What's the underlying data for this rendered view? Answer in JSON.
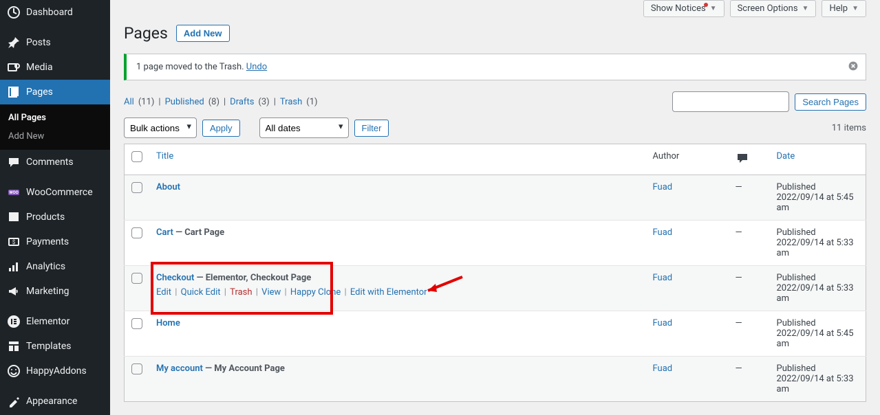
{
  "sidebar": {
    "items": [
      {
        "label": "Dashboard",
        "icon": "dashboard"
      },
      {
        "label": "Posts",
        "icon": "posts"
      },
      {
        "label": "Media",
        "icon": "media"
      },
      {
        "label": "Pages",
        "icon": "pages",
        "active": true
      },
      {
        "label": "Comments",
        "icon": "comments"
      },
      {
        "label": "WooCommerce",
        "icon": "woo"
      },
      {
        "label": "Products",
        "icon": "products"
      },
      {
        "label": "Payments",
        "icon": "payments"
      },
      {
        "label": "Analytics",
        "icon": "analytics"
      },
      {
        "label": "Marketing",
        "icon": "marketing"
      },
      {
        "label": "Elementor",
        "icon": "elementor"
      },
      {
        "label": "Templates",
        "icon": "templates"
      },
      {
        "label": "HappyAddons",
        "icon": "happy"
      },
      {
        "label": "Appearance",
        "icon": "appearance"
      }
    ],
    "sub": [
      {
        "label": "All Pages",
        "current": true
      },
      {
        "label": "Add New"
      }
    ]
  },
  "topbar": {
    "show_notices": "Show Notices",
    "screen_options": "Screen Options",
    "help": "Help"
  },
  "header": {
    "title": "Pages",
    "add_new": "Add New"
  },
  "notice": {
    "text": "1 page moved to the Trash.",
    "undo": "Undo"
  },
  "filters": {
    "all": "All",
    "all_count": "(11)",
    "published": "Published",
    "published_count": "(8)",
    "drafts": "Drafts",
    "drafts_count": "(3)",
    "trash": "Trash",
    "trash_count": "(1)"
  },
  "search_btn": "Search Pages",
  "bulk": {
    "bulk_actions": "Bulk actions",
    "apply": "Apply",
    "all_dates": "All dates",
    "filter": "Filter",
    "items_count": "11 items"
  },
  "columns": {
    "title": "Title",
    "author": "Author",
    "date": "Date"
  },
  "rows": [
    {
      "title": "About",
      "meta": "",
      "author": "Fuad",
      "comments": "—",
      "date_status": "Published",
      "date": "2022/09/14 at 5:45 am"
    },
    {
      "title": "Cart",
      "meta": " — Cart Page",
      "author": "Fuad",
      "comments": "—",
      "date_status": "Published",
      "date": "2022/09/14 at 5:33 am"
    },
    {
      "title": "Checkout",
      "meta": " — Elementor, Checkout Page",
      "author": "Fuad",
      "comments": "—",
      "date_status": "Published",
      "date": "2022/09/14 at 5:33 am",
      "show_actions": true,
      "highlight": true,
      "actions": {
        "edit": "Edit",
        "quick_edit": "Quick Edit",
        "trash": "Trash",
        "view": "View",
        "happy_clone": "Happy Clone",
        "edit_elementor": "Edit with Elementor"
      }
    },
    {
      "title": "Home",
      "meta": "",
      "author": "Fuad",
      "comments": "—",
      "date_status": "Published",
      "date": "2022/09/14 at 5:45 am"
    },
    {
      "title": "My account",
      "meta": " — My Account Page",
      "author": "Fuad",
      "comments": "—",
      "date_status": "Published",
      "date": "2022/09/14 at 5:33 am"
    }
  ]
}
